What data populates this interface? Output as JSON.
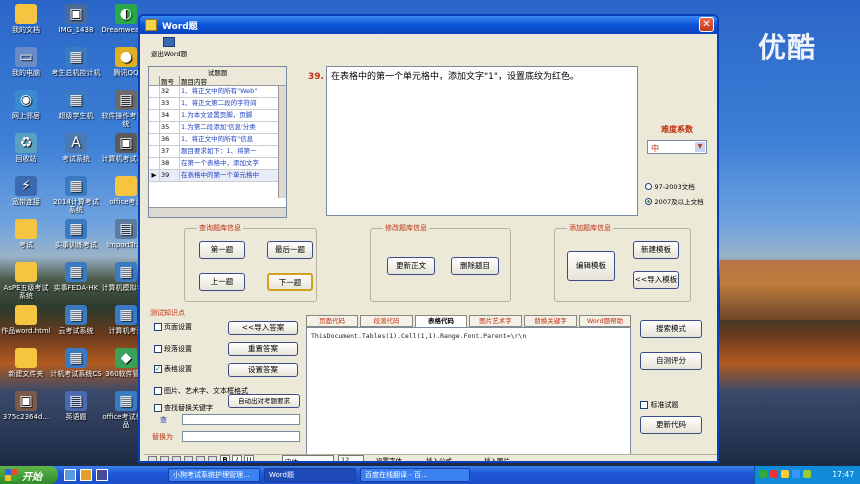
{
  "desktop": {
    "watermark": "优酷",
    "icons": [
      {
        "label": "我的文档",
        "glyph": "📁",
        "color": "#f5c542"
      },
      {
        "label": "IMG_1438",
        "glyph": "▣",
        "color": "#4a6a9a"
      },
      {
        "label": "Dreamweaver",
        "glyph": "◐",
        "color": "#2aa84a"
      },
      {
        "label": "我的电脑",
        "glyph": "▭",
        "color": "#6a8ac8"
      },
      {
        "label": "考生总机控计机",
        "glyph": "▦",
        "color": "#3a7ac0"
      },
      {
        "label": "腾讯QQ",
        "glyph": "●",
        "color": "#e0b020"
      },
      {
        "label": "网上邻居",
        "glyph": "◉",
        "color": "#3a8ad0"
      },
      {
        "label": "超级学生机",
        "glyph": "▦",
        "color": "#3a7ac0"
      },
      {
        "label": "软件操作考试系统",
        "glyph": "▤",
        "color": "#6a6a6a"
      },
      {
        "label": "回收站",
        "glyph": "♻",
        "color": "#5aa0c0"
      },
      {
        "label": "考试系统",
        "glyph": "A",
        "color": "#4a7ab0"
      },
      {
        "label": "计算机考试系统",
        "glyph": "▣",
        "color": "#5a5a5a"
      },
      {
        "label": "宽带连接",
        "glyph": "⚡",
        "color": "#3a6ab0"
      },
      {
        "label": "2014计算考试系统",
        "glyph": "▦",
        "color": "#3a7ac0"
      },
      {
        "label": "office考试",
        "glyph": "📁",
        "color": "#f5c542"
      },
      {
        "label": "考试",
        "glyph": "📁",
        "color": "#f5c542"
      },
      {
        "label": "实事训练考试",
        "glyph": "▦",
        "color": "#3a7ac0"
      },
      {
        "label": "ImportTran",
        "glyph": "▤",
        "color": "#5a7aa0"
      },
      {
        "label": "AsPE五级考试系统",
        "glyph": "📁",
        "color": "#f5c542"
      },
      {
        "label": "实事FEDA-HK",
        "glyph": "▦",
        "color": "#3a7ac0"
      },
      {
        "label": "计算机模拟考试",
        "glyph": "▦",
        "color": "#3a7ac0"
      },
      {
        "label": "作品word.html",
        "glyph": "📁",
        "color": "#f5c542"
      },
      {
        "label": "云考试系统",
        "glyph": "▦",
        "color": "#3a7ac0"
      },
      {
        "label": "计算机考试",
        "glyph": "▦",
        "color": "#3a7ac0"
      },
      {
        "label": "新建文件夹",
        "glyph": "📁",
        "color": "#f5c542"
      },
      {
        "label": "计机考试系统CS",
        "glyph": "▦",
        "color": "#3a7ac0"
      },
      {
        "label": "360软件管家",
        "glyph": "◆",
        "color": "#3aa05a"
      },
      {
        "label": "375c2364d...",
        "glyph": "▣",
        "color": "#7a5a4a"
      },
      {
        "label": "英语题",
        "glyph": "▤",
        "color": "#4a6ab0"
      },
      {
        "label": "office考试作业品",
        "glyph": "▦",
        "color": "#3a7ac0"
      }
    ]
  },
  "window": {
    "title": "Word题",
    "toolbar_label": "退出Word题",
    "list": {
      "caption": "试题题",
      "col_num": "题号",
      "col_content": "题目内容",
      "rows": [
        {
          "num": "32",
          "text": "1、将正文中的所有\"Web\""
        },
        {
          "num": "33",
          "text": "1、将正文第二段的字符间"
        },
        {
          "num": "34",
          "text": "1.为本文设置页脚，页脚"
        },
        {
          "num": "35",
          "text": "1.为第二段添加'信息'分类"
        },
        {
          "num": "36",
          "text": "1、将正文中的所有\"信息"
        },
        {
          "num": "37",
          "text": "题目要求如下：1、将第一"
        },
        {
          "num": "38",
          "text": "在第一个表格中，添加文字"
        },
        {
          "num": "39",
          "text": "在表格中的第一个单元格中"
        }
      ],
      "selected": "39"
    },
    "question": {
      "number": "39.",
      "text": "在表格中的第一个单元格中，添加文字\"1\"，设置底纹为红色。"
    },
    "difficulty": {
      "label": "难度系数",
      "value": "中"
    },
    "versions": {
      "opt1": "97-2003文档",
      "opt2": "2007及以上文档"
    },
    "query_group": {
      "title": "查询题库信息",
      "first": "第一题",
      "last": "最后一题",
      "prev": "上一题",
      "next": "下一题"
    },
    "modify_group": {
      "title": "修改题库信息",
      "update": "更新正文",
      "delete": "删除题目"
    },
    "add_group": {
      "title": "添加题库信息",
      "edit": "编辑模板",
      "new": "新建模板",
      "import": "<<导入模板"
    },
    "knowledge": {
      "title": "测试知识点",
      "items": [
        "页面设置",
        "段落设置",
        "表格设置",
        "图片、艺术字、文本框格式",
        "查找替换关键字"
      ],
      "checked": [
        false,
        false,
        true,
        false,
        false
      ],
      "import_answer": "<<导入答案",
      "reset_answer": "重置答案",
      "set_answer": "设置答案",
      "auto_eval": "自动出对考题要求",
      "find_label": "查",
      "replace_label": "替换为"
    },
    "tabs": [
      "页面代码",
      "段落代码",
      "表格代码",
      "图片艺术字",
      "替换关键字",
      "Word题帮助"
    ],
    "active_tab": 2,
    "code": "ThisDocument.Tables(1).Cell(1,1).Range.Font.Parent=\\r\\n",
    "right_buttons": {
      "search_mode": "搜索模式",
      "self_eval": "自测评分",
      "update_code": "更新代码",
      "std_test": "标准试题"
    },
    "formatbar": {
      "font": "宋体",
      "size": "12",
      "bold": "B",
      "italic": "I",
      "underline": "U",
      "set_font": "设置字体",
      "insert_formula": "插入公式",
      "insert_image": "插入图片"
    }
  },
  "taskbar": {
    "start": "开始",
    "tasks": [
      "小狗考试系统护理管理...",
      "Word题",
      "百度在线翻译 - 百..."
    ],
    "clock": "17:47"
  },
  "colors": {
    "title_blue": "#0b53d6",
    "accent_red": "#c03010",
    "selected_row": "#316ac5"
  }
}
